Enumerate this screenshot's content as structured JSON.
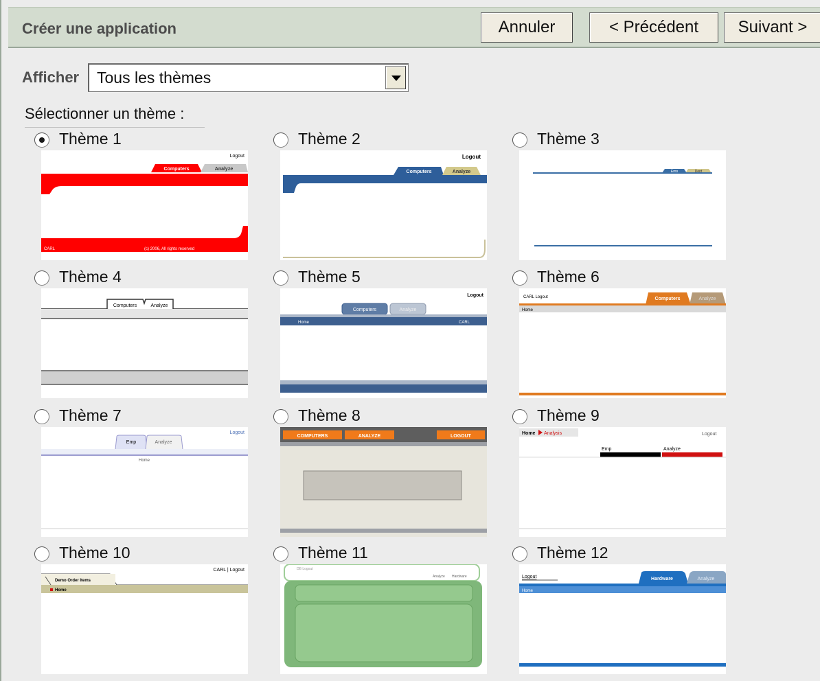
{
  "header": {
    "title": "Créer une application",
    "cancel_label": "Annuler",
    "prev_label": "< Précédent",
    "next_label": "Suivant >"
  },
  "filter": {
    "label": "Afficher",
    "selected": "Tous les thèmes"
  },
  "select_theme_label": "Sélectionner un thème :",
  "selected_theme_index": 0,
  "themes": [
    {
      "name": "Thème 1",
      "selected": true,
      "preview": {
        "logout": "Logout",
        "tab_active": "Computers",
        "tab_inactive": "Analyze",
        "footer": "CARL",
        "footer_right": "(c) 2006, All rights reserved",
        "accent": "#ff0000"
      }
    },
    {
      "name": "Thème 2",
      "selected": false,
      "preview": {
        "logout": "Logout",
        "tab_active": "Computers",
        "tab_inactive": "Analyze",
        "accent": "#2e5e9a"
      }
    },
    {
      "name": "Thème 3",
      "selected": false,
      "preview": {
        "tab_active": "Emp",
        "tab_inactive": "Dept",
        "accent": "#3a6ea5"
      }
    },
    {
      "name": "Thème 4",
      "selected": false,
      "preview": {
        "tab_active": "Computers",
        "tab_inactive": "Analyze",
        "accent": "#555555"
      }
    },
    {
      "name": "Thème 5",
      "selected": false,
      "preview": {
        "logout": "Logout",
        "tab_active": "Computers",
        "tab_inactive": "Analyze",
        "bar_left": "Home",
        "bar_right": "CARL",
        "accent": "#3d5f8f"
      }
    },
    {
      "name": "Thème 6",
      "selected": false,
      "preview": {
        "logout": "CARL Logout",
        "tab_active": "Computers",
        "tab_inactive": "Analyze",
        "bar_left": "Home",
        "accent": "#e07a20"
      }
    },
    {
      "name": "Thème 7",
      "selected": false,
      "preview": {
        "logout": "Logout",
        "tab_active": "Emp",
        "tab_inactive": "Analyze",
        "bar_left": "Home",
        "accent": "#9b9bd0"
      }
    },
    {
      "name": "Thème 8",
      "selected": false,
      "preview": {
        "tab_active": "COMPUTERS",
        "tab_inactive": "ANALYZE",
        "logout": "LOGOUT",
        "accent": "#f07a1a"
      }
    },
    {
      "name": "Thème 9",
      "selected": false,
      "preview": {
        "breadcrumb": "Home",
        "breadcrumb_active": "Analysis",
        "logout": "Logout",
        "tab_active": "Emp",
        "tab_inactive": "Analyze",
        "accent": "#d01010"
      }
    },
    {
      "name": "Thème 10",
      "selected": false,
      "preview": {
        "logout": "CARL | Logout",
        "tab_active": "Demo Order Items",
        "bar_left": "Home",
        "accent": "#c9c49a"
      }
    },
    {
      "name": "Thème 11",
      "selected": false,
      "preview": {
        "logout": "DB Logout",
        "tab_active": "Analyze",
        "tab_inactive": "Hardware",
        "accent": "#7fb77a"
      }
    },
    {
      "name": "Thème 12",
      "selected": false,
      "preview": {
        "logout": "Logout",
        "tab_active": "Hardware",
        "tab_inactive": "Analyze",
        "bar_left": "Home",
        "accent": "#1f6fc0"
      }
    }
  ],
  "colors": {
    "header_bg": "#d3dccf",
    "page_bg": "#ececec",
    "button_bg": "#f0ece1"
  }
}
